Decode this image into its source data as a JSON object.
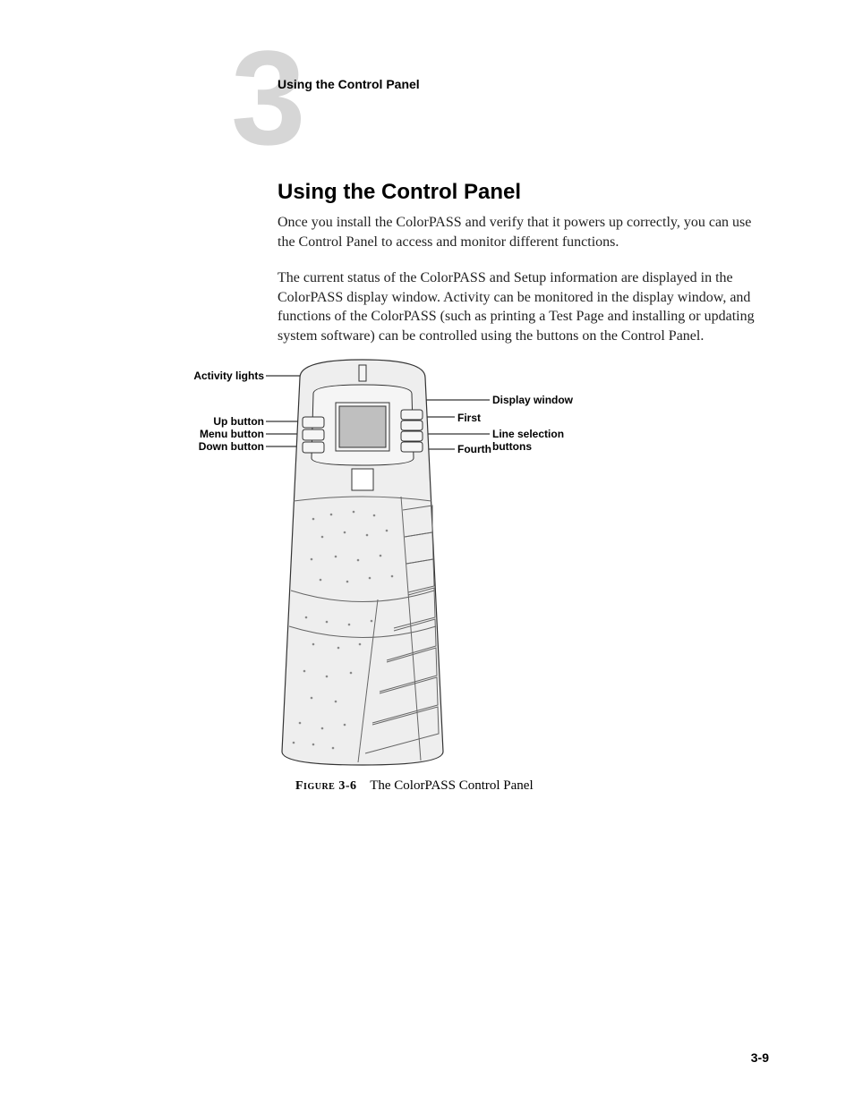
{
  "header": {
    "chapter_number": "3",
    "running_title": "Using the Control Panel"
  },
  "section": {
    "heading": "Using the Control Panel",
    "paragraph1": "Once you install the ColorPASS and verify that it powers up correctly, you can use the Control Panel to access and monitor different functions.",
    "paragraph2": "The current status of the ColorPASS and Setup information are displayed in the ColorPASS display window. Activity can be monitored in the display window, and functions of the ColorPASS (such as printing a Test Page and installing or updating system software) can be controlled using the buttons on the Control Panel."
  },
  "figure": {
    "callouts": {
      "activity_lights": "Activity lights",
      "up_button": "Up button",
      "menu_button": "Menu button",
      "down_button": "Down button",
      "display_window": "Display window",
      "first": "First",
      "fourth": "Fourth",
      "line_selection": "Line selection",
      "buttons": "buttons"
    },
    "caption_label": "Figure 3-6",
    "caption_text": "The ColorPASS Control Panel"
  },
  "page_number": "3-9"
}
